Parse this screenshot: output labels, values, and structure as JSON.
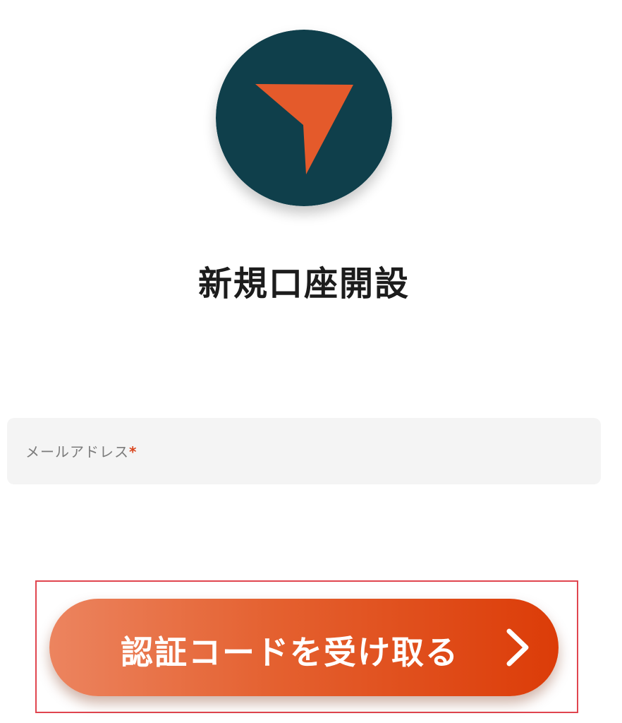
{
  "logo": {
    "icon": "arrow-pointer-icon",
    "circle_color": "#0f3f4b",
    "arrow_color": "#e45a2b"
  },
  "page": {
    "title": "新規口座開設"
  },
  "form": {
    "email": {
      "label": "メールアドレス",
      "required_mark": "*",
      "value": ""
    }
  },
  "actions": {
    "receive_code_label": "認証コードを受け取る",
    "gradient_start": "#ec845f",
    "gradient_end": "#dc3c08"
  }
}
